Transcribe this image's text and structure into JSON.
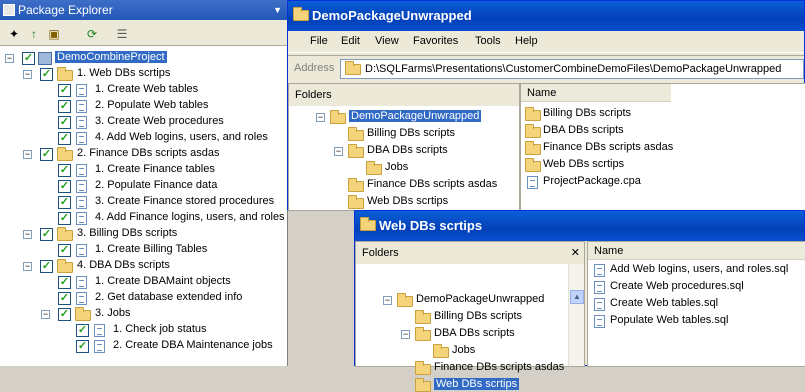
{
  "package_explorer": {
    "title": "Package Explorer",
    "root": "DemoCombineProject",
    "items": [
      {
        "label": "1. Web DBs scrtips"
      },
      {
        "label": "1. Create Web tables"
      },
      {
        "label": "2. Populate Web tables"
      },
      {
        "label": "3. Create Web procedures"
      },
      {
        "label": "4. Add Web logins, users, and roles"
      },
      {
        "label": "2. Finance DBs scripts asdas"
      },
      {
        "label": "1. Create Finance tables"
      },
      {
        "label": "2. Populate Finance data"
      },
      {
        "label": "3. Create Finance stored procedures"
      },
      {
        "label": "4. Add Finance logins, users, and roles"
      },
      {
        "label": "3. Billing DBs scripts"
      },
      {
        "label": "1. Create Billing Tables"
      },
      {
        "label": "4. DBA DBs scripts"
      },
      {
        "label": "1. Create DBAMaint objects"
      },
      {
        "label": "2. Get database extended info"
      },
      {
        "label": "3. Jobs"
      },
      {
        "label": "1. Check job status"
      },
      {
        "label": "2. Create DBA Maintenance jobs"
      }
    ]
  },
  "window1": {
    "title": "DemoPackageUnwrapped",
    "menu": [
      "File",
      "Edit",
      "View",
      "Favorites",
      "Tools",
      "Help"
    ],
    "address_label": "Address",
    "address": "D:\\SQLFarms\\Presentations\\CustomerCombineDemoFiles\\DemoPackageUnwrapped",
    "folders_label": "Folders",
    "tree": [
      "DemoPackageUnwrapped",
      "Billing DBs scripts",
      "DBA DBs scripts",
      "Jobs",
      "Finance DBs scripts asdas",
      "Web DBs scrtips"
    ],
    "name_header": "Name",
    "files": [
      "Billing DBs scripts",
      "DBA DBs scripts",
      "Finance DBs scripts asdas",
      "Web DBs scrtips",
      "ProjectPackage.cpa"
    ]
  },
  "window2": {
    "title": "Web DBs scrtips",
    "folders_label": "Folders",
    "tree": [
      "DemoPackageUnwrapped",
      "Billing DBs scripts",
      "DBA DBs scripts",
      "Jobs",
      "Finance DBs scripts asdas",
      "Web DBs scrtips"
    ],
    "name_header": "Name",
    "files": [
      "Add Web logins, users, and roles.sql",
      "Create Web procedures.sql",
      "Create Web tables.sql",
      "Populate Web tables.sql"
    ]
  }
}
